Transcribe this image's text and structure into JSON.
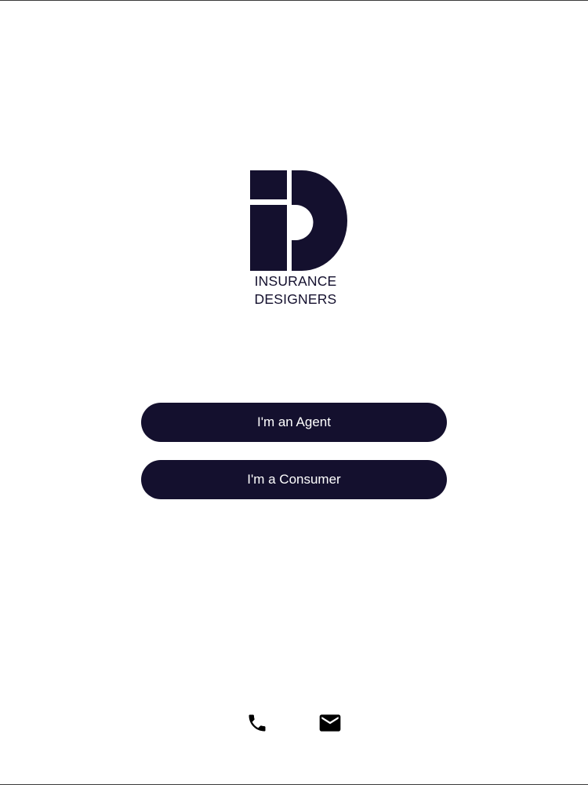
{
  "logo": {
    "line1": "INSURANCE",
    "line2": "DESIGNERS",
    "brand_color": "#14102e"
  },
  "buttons": {
    "agent_label": "I'm an Agent",
    "consumer_label": "I'm a Consumer",
    "background_color": "#14102e",
    "text_color": "#ffffff"
  },
  "footer": {
    "icons": [
      "phone-icon",
      "mail-icon"
    ]
  }
}
